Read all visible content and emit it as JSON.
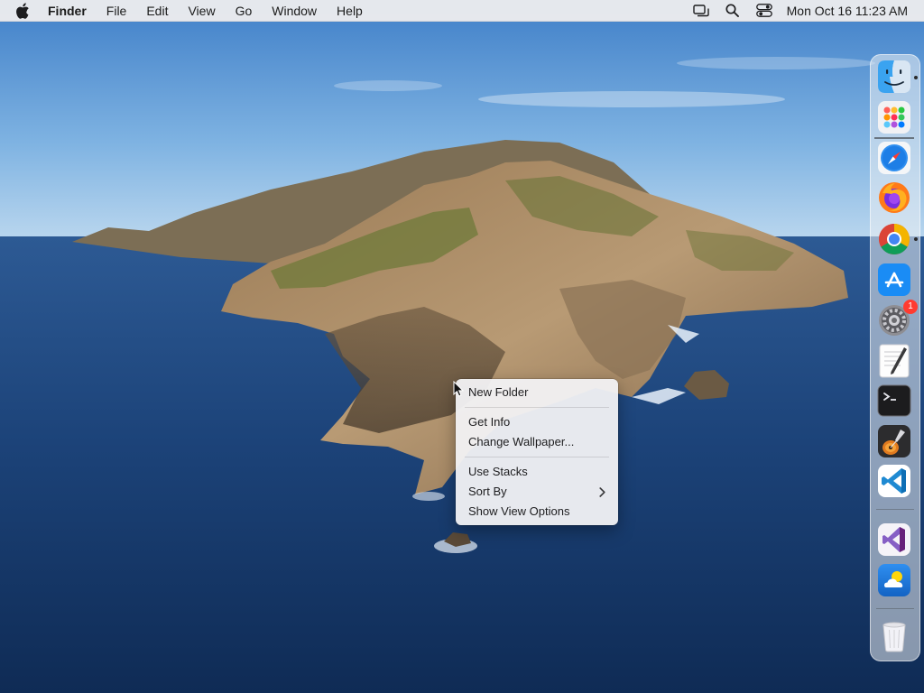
{
  "menubar": {
    "app_name": "Finder",
    "items": [
      "File",
      "Edit",
      "View",
      "Go",
      "Window",
      "Help"
    ],
    "clock": "Mon Oct 16  11:23 AM",
    "status_icons": [
      "screen-mirroring-icon",
      "search-icon",
      "control-center-icon"
    ]
  },
  "context_menu": {
    "items": [
      {
        "label": "New Folder"
      },
      {
        "label": "Get Info"
      },
      {
        "label": "Change Wallpaper..."
      },
      {
        "label": "Use Stacks"
      },
      {
        "label": "Sort By",
        "submenu": true
      },
      {
        "label": "Show View Options"
      }
    ]
  },
  "dock": {
    "apps": [
      {
        "name": "Finder",
        "icon": "finder-icon",
        "running": true
      },
      {
        "name": "Launchpad",
        "icon": "launchpad-icon",
        "running": false
      },
      {
        "name": "Safari",
        "icon": "safari-icon",
        "running": false
      },
      {
        "name": "Firefox",
        "icon": "firefox-icon",
        "running": false
      },
      {
        "name": "Google Chrome",
        "icon": "chrome-icon",
        "running": true
      },
      {
        "name": "App Store",
        "icon": "app-store-icon",
        "running": false
      },
      {
        "name": "System Settings",
        "icon": "system-settings-icon",
        "running": false,
        "badge": "1"
      },
      {
        "name": "TextEdit",
        "icon": "textedit-icon",
        "running": false
      },
      {
        "name": "Terminal",
        "icon": "terminal-icon",
        "running": false
      },
      {
        "name": "GarageBand",
        "icon": "garageband-icon",
        "running": false
      },
      {
        "name": "Visual Studio Code",
        "icon": "vscode-icon",
        "running": false
      },
      {
        "name": "Visual Studio",
        "icon": "visual-studio-icon",
        "running": false
      },
      {
        "name": "Weather",
        "icon": "weather-icon",
        "running": false
      },
      {
        "name": "Trash",
        "icon": "trash-icon",
        "running": false
      }
    ]
  },
  "colors": {
    "accent": "#0a84ff",
    "badge": "#ff3b30",
    "sea": "#1b3d6b",
    "sky": "#6ba4d9"
  }
}
